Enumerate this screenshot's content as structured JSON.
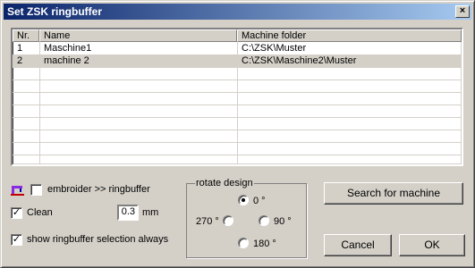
{
  "window": {
    "title": "Set ZSK ringbuffer",
    "close_glyph": "×"
  },
  "table": {
    "columns": [
      "Nr.",
      "Name",
      "Machine folder"
    ],
    "rows": [
      {
        "nr": "1",
        "name": "Maschine1",
        "folder": "C:\\ZSK\\Muster"
      },
      {
        "nr": "2",
        "name": "machine 2",
        "folder": "C:\\ZSK\\Maschine2\\Muster"
      }
    ]
  },
  "options": {
    "embroider_label": "embroider >> ringbuffer",
    "embroider_checked": false,
    "embroider_icon": "machine-icon",
    "clean_label": "Clean",
    "clean_checked": true,
    "clean_value": "0.3",
    "clean_unit": "mm",
    "show_label": "show ringbuffer selection always",
    "show_checked": true
  },
  "rotate": {
    "title": "rotate design",
    "r0": "0 °",
    "r90": "90 °",
    "r180": "180 °",
    "r270": "270 °",
    "selected": "0 °"
  },
  "buttons": {
    "search": "Search for machine",
    "cancel": "Cancel",
    "ok": "OK"
  }
}
